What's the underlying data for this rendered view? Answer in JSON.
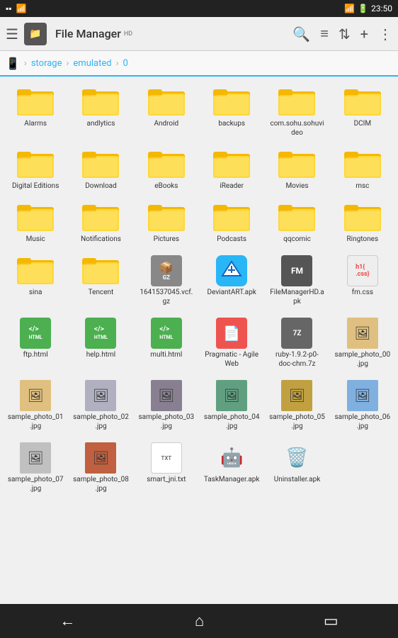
{
  "statusBar": {
    "time": "23:50",
    "icons": [
      "wifi",
      "battery"
    ]
  },
  "toolbar": {
    "menuIcon": "☰",
    "appName": "File Manager",
    "hdLabel": "HD",
    "searchIcon": "search",
    "listIcon": "list",
    "sortIcon": "sort",
    "addIcon": "+",
    "moreIcon": "⋮"
  },
  "breadcrumb": {
    "deviceIcon": "📱",
    "items": [
      "storage",
      "emulated",
      "0"
    ]
  },
  "files": [
    {
      "name": "Alarms",
      "type": "folder"
    },
    {
      "name": "andlytics",
      "type": "folder"
    },
    {
      "name": "Android",
      "type": "folder"
    },
    {
      "name": "backups",
      "type": "folder"
    },
    {
      "name": "com.sohu.sohuvideo",
      "type": "folder"
    },
    {
      "name": "DCIM",
      "type": "folder"
    },
    {
      "name": "Digital Editions",
      "type": "folder"
    },
    {
      "name": "Download",
      "type": "folder"
    },
    {
      "name": "eBooks",
      "type": "folder"
    },
    {
      "name": "iReader",
      "type": "folder"
    },
    {
      "name": "Movies",
      "type": "folder"
    },
    {
      "name": "msc",
      "type": "folder"
    },
    {
      "name": "Music",
      "type": "folder"
    },
    {
      "name": "Notifications",
      "type": "folder"
    },
    {
      "name": "Pictures",
      "type": "folder"
    },
    {
      "name": "Podcasts",
      "type": "folder"
    },
    {
      "name": "qqcomic",
      "type": "folder"
    },
    {
      "name": "Ringtones",
      "type": "folder"
    },
    {
      "name": "sina",
      "type": "folder"
    },
    {
      "name": "Tencent",
      "type": "folder"
    },
    {
      "name": "1641537045.vcf.gz",
      "type": "gz"
    },
    {
      "name": "DeviantART.apk",
      "type": "apk-dd"
    },
    {
      "name": "FileManagerHD.apk",
      "type": "apk-fm"
    },
    {
      "name": "fm.css",
      "type": "css"
    },
    {
      "name": "ftp.html",
      "type": "html"
    },
    {
      "name": "help.html",
      "type": "html"
    },
    {
      "name": "multi.html",
      "type": "html"
    },
    {
      "name": "Pragmatic - Agile Web",
      "type": "pdf"
    },
    {
      "name": "ruby-1.9.2-p0-doc-chm.7z",
      "type": "7z"
    },
    {
      "name": "sample_photo_00.jpg",
      "type": "photo",
      "photoClass": "photo-01"
    },
    {
      "name": "sample_photo_01.jpg",
      "type": "photo",
      "photoClass": "photo-01"
    },
    {
      "name": "sample_photo_02.jpg",
      "type": "photo",
      "photoClass": "photo-02"
    },
    {
      "name": "sample_photo_03.jpg",
      "type": "photo",
      "photoClass": "photo-03"
    },
    {
      "name": "sample_photo_04.jpg",
      "type": "photo",
      "photoClass": "photo-04"
    },
    {
      "name": "sample_photo_05.jpg",
      "type": "photo",
      "photoClass": "photo-05"
    },
    {
      "name": "sample_photo_06.jpg",
      "type": "photo",
      "photoClass": "photo-06"
    },
    {
      "name": "sample_photo_07.jpg",
      "type": "photo",
      "photoClass": "photo-07"
    },
    {
      "name": "sample_photo_08.jpg",
      "type": "photo",
      "photoClass": "photo-08"
    },
    {
      "name": "smart_jni.txt",
      "type": "txt"
    },
    {
      "name": "TaskManager.apk",
      "type": "apk-task"
    },
    {
      "name": "Uninstaller.apk",
      "type": "apk-uninstall"
    }
  ],
  "bottomNav": {
    "backIcon": "←",
    "homeIcon": "⌂",
    "recentIcon": "▭"
  }
}
